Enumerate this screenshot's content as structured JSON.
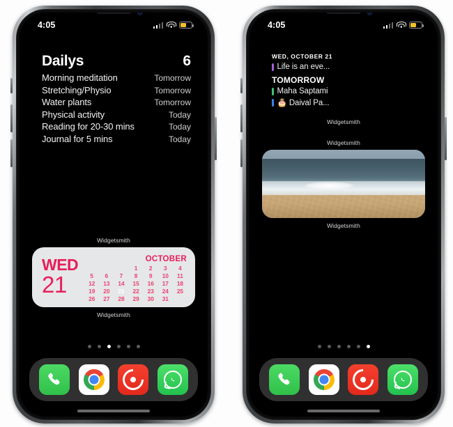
{
  "phones": [
    {
      "id": "left-phone",
      "status": {
        "time": "4:05",
        "signal_icon": "cellular-signal-icon",
        "wifi_icon": "wifi-icon",
        "battery_icon": "battery-low-power-icon"
      },
      "widgets": {
        "dailys": {
          "label_top": "",
          "title": "Dailys",
          "count": "6",
          "items": [
            {
              "name": "Morning meditation",
              "when": "Tomorrow"
            },
            {
              "name": "Stretching/Physio",
              "when": "Tomorrow"
            },
            {
              "name": "Water plants",
              "when": "Tomorrow"
            },
            {
              "name": "Physical activity",
              "when": "Today"
            },
            {
              "name": "Reading for 20-30 mins",
              "when": "Today"
            },
            {
              "name": "Journal for 5 mins",
              "when": "Today"
            }
          ]
        },
        "calendar": {
          "label_top": "Widgetsmith",
          "label_bottom": "Widgetsmith",
          "weekday": "WED",
          "day": "21",
          "month": "OCTOBER",
          "accent_color": "#e81e5a",
          "background_color": "#e6e7e8",
          "leading_blanks": 3,
          "days_in_month": 31,
          "today": 21
        }
      },
      "page_dots": {
        "count": 6,
        "active_index": 2
      }
    },
    {
      "id": "right-phone",
      "status": {
        "time": "4:05",
        "signal_icon": "cellular-signal-icon",
        "wifi_icon": "wifi-icon",
        "battery_icon": "battery-low-power-icon"
      },
      "widgets": {
        "events": {
          "date_header": "WED, OCTOBER 21",
          "today_events": [
            {
              "title": "Life is an eve...",
              "color": "#a35fd8"
            }
          ],
          "tomorrow_header": "TOMORROW",
          "tomorrow_events": [
            {
              "title": "Maha Saptami",
              "color": "#3ec46d"
            },
            {
              "title": "🎂 Daival Pa...",
              "color": "#3b82e8"
            }
          ],
          "label_bottom": "Widgetsmith"
        },
        "photo": {
          "label_top": "Widgetsmith",
          "label_bottom": "Widgetsmith",
          "description": "beach-wave-photo"
        }
      },
      "page_dots": {
        "count": 6,
        "active_index": 5
      }
    }
  ],
  "dock": {
    "apps": [
      {
        "name": "Phone",
        "icon": "phone-icon",
        "color": "#34c759"
      },
      {
        "name": "Chrome",
        "icon": "chrome-icon",
        "color": "#ffffff"
      },
      {
        "name": "Pocket Casts",
        "icon": "pocket-casts-icon",
        "color": "#f43f2f"
      },
      {
        "name": "WhatsApp",
        "icon": "whatsapp-icon",
        "color": "#25d366"
      }
    ]
  }
}
